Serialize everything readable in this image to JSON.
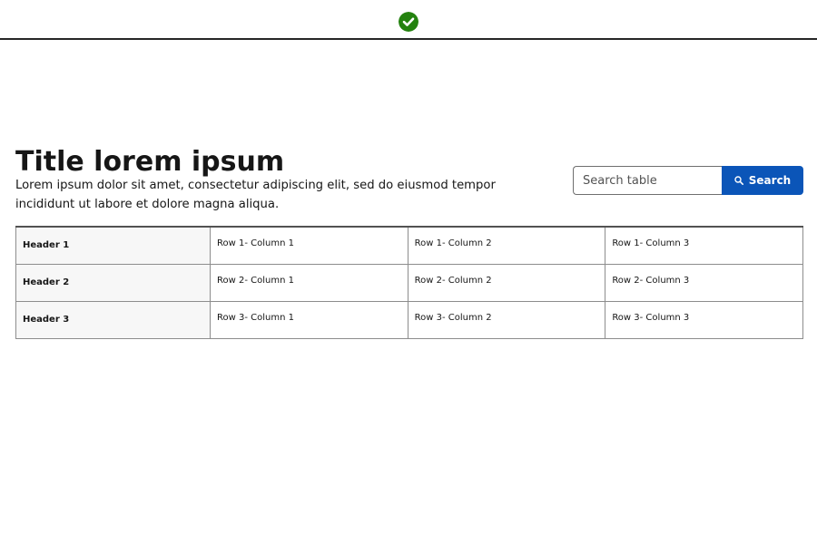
{
  "status": {
    "icon": "check-circle-icon",
    "color": "#24820f"
  },
  "page": {
    "title": "Title lorem ipsum",
    "description": "Lorem ipsum dolor sit amet, consectetur adipiscing elit, sed do eiusmod tempor incididunt ut labore et dolore magna aliqua."
  },
  "search": {
    "placeholder": "Search table",
    "value": "",
    "button_label": "Search",
    "button_icon": "search-icon",
    "button_color": "#0b55b8"
  },
  "table": {
    "rows": [
      {
        "header": "Header 1",
        "cells": [
          "Row 1- Column 1",
          "Row 1- Column 2",
          "Row 1- Column 3"
        ]
      },
      {
        "header": "Header 2",
        "cells": [
          "Row 2- Column 1",
          "Row 2- Column 2",
          "Row 2- Column 3"
        ]
      },
      {
        "header": "Header 3",
        "cells": [
          "Row 3- Column 1",
          "Row 3- Column 2",
          "Row 3- Column 3"
        ]
      }
    ]
  }
}
